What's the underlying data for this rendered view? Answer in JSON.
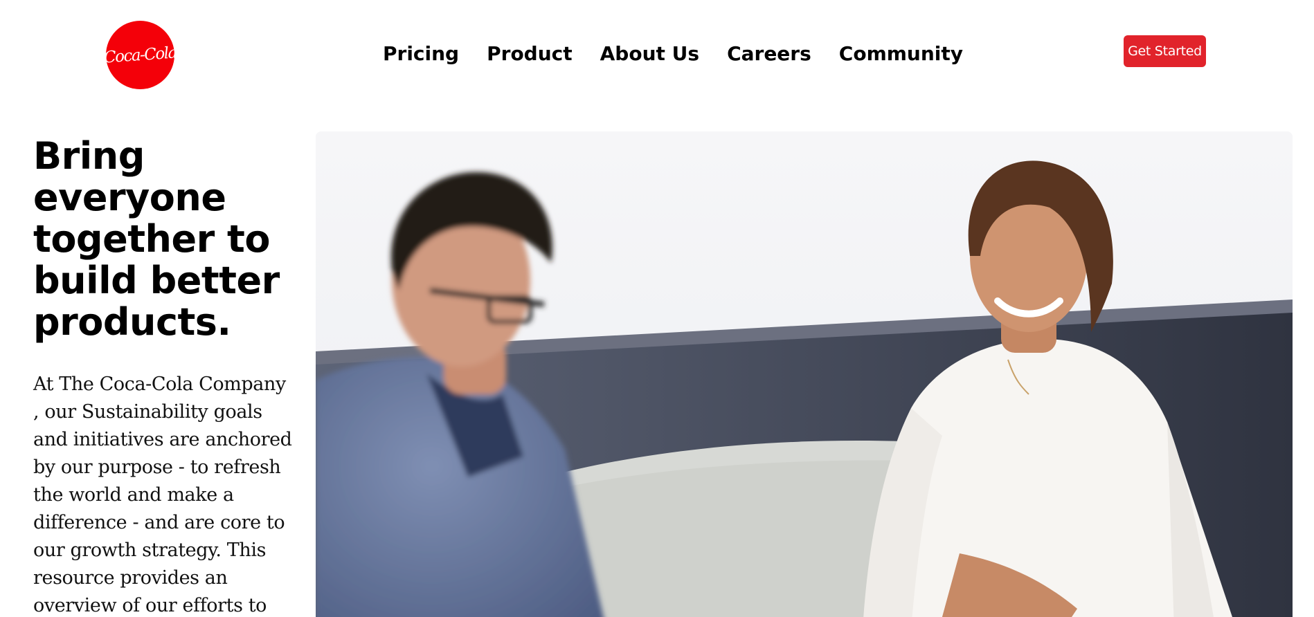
{
  "header": {
    "logo_text": "Coca-Cola",
    "nav": [
      {
        "label": "Pricing"
      },
      {
        "label": "Product"
      },
      {
        "label": "About Us"
      },
      {
        "label": "Careers"
      },
      {
        "label": "Community"
      }
    ],
    "cta_label": "Get Started"
  },
  "hero": {
    "title": "Bring everyone together to build better products.",
    "body": "At The Coca-Cola Company , our Sustainability goals and initiatives are anchored by our purpose - to refresh the world and make a difference - and are core to our growth strategy. This resource provides an overview of our efforts to"
  },
  "colors": {
    "brand_red": "#f40009",
    "cta_red": "#e1232b"
  }
}
